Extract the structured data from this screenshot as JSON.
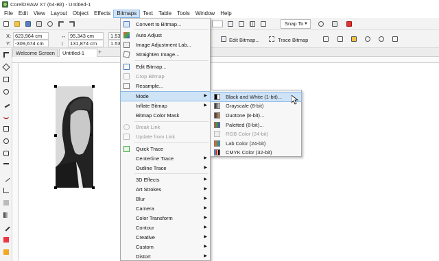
{
  "window": {
    "title": "CorelDRAW X7 (64-Bit) - Untitled-1"
  },
  "menubar": [
    "File",
    "Edit",
    "View",
    "Layout",
    "Object",
    "Effects",
    "Bitmaps",
    "Text",
    "Table",
    "Tools",
    "Window",
    "Help"
  ],
  "active_menu": "Bitmaps",
  "toolbar": {
    "snap_label": "Snap To",
    "x_label": "X:",
    "x_value": "623,964 cm",
    "y_label": "Y:",
    "y_value": "-309,674 cm",
    "w_value": "95,343 cm",
    "h_value": "131,874 cm",
    "scale_w": "1.53",
    "scale_h": "1.53",
    "edit_bitmap": "Edit Bitmap...",
    "trace_bitmap": "Trace Bitmap"
  },
  "tabs": {
    "welcome": "Welcome Screen",
    "document": "Untitled-1",
    "add": "+"
  },
  "bitmaps_menu": [
    {
      "label": "Convert to Bitmap...",
      "disabled": false,
      "icon": "convert-bitmap-icon"
    },
    {
      "label": "Auto Adjust",
      "disabled": false,
      "icon": "auto-adjust-icon"
    },
    {
      "label": "Image Adjustment Lab...",
      "disabled": false,
      "icon": "image-adjustment-icon"
    },
    {
      "label": "Straighten Image...",
      "disabled": false,
      "icon": "straighten-icon"
    },
    {
      "label": "Edit Bitmap...",
      "disabled": false,
      "icon": "edit-bitmap-icon"
    },
    {
      "label": "Crop Bitmap",
      "disabled": true,
      "icon": "crop-icon"
    },
    {
      "label": "Resample...",
      "disabled": false,
      "icon": "resample-icon"
    },
    {
      "label": "Mode",
      "disabled": false,
      "submenu": true,
      "highlight": true
    },
    {
      "label": "Inflate Bitmap",
      "disabled": false,
      "submenu": true
    },
    {
      "label": "Bitmap Color Mask",
      "disabled": false
    },
    {
      "label": "Break Link",
      "disabled": true,
      "icon": "break-link-icon"
    },
    {
      "label": "Update from Link",
      "disabled": true,
      "icon": "update-link-icon"
    },
    {
      "label": "Quick Trace",
      "disabled": false,
      "icon": "quick-trace-icon"
    },
    {
      "label": "Centerline Trace",
      "disabled": false,
      "submenu": true
    },
    {
      "label": "Outline Trace",
      "disabled": false,
      "submenu": true
    },
    {
      "label": "3D Effects",
      "disabled": false,
      "submenu": true
    },
    {
      "label": "Art Strokes",
      "disabled": false,
      "submenu": true
    },
    {
      "label": "Blur",
      "disabled": false,
      "submenu": true
    },
    {
      "label": "Camera",
      "disabled": false,
      "submenu": true
    },
    {
      "label": "Color Transform",
      "disabled": false,
      "submenu": true
    },
    {
      "label": "Contour",
      "disabled": false,
      "submenu": true
    },
    {
      "label": "Creative",
      "disabled": false,
      "submenu": true
    },
    {
      "label": "Custom",
      "disabled": false,
      "submenu": true
    },
    {
      "label": "Distort",
      "disabled": false,
      "submenu": true
    }
  ],
  "mode_submenu": [
    {
      "label": "Black and White (1-bit)...",
      "disabled": false,
      "highlight": true
    },
    {
      "label": "Grayscale (8-bit)",
      "disabled": false
    },
    {
      "label": "Duotone (8-bit)...",
      "disabled": false
    },
    {
      "label": "Paletted (8-bit)...",
      "disabled": false
    },
    {
      "label": "RGB Color (24-bit)",
      "disabled": true
    },
    {
      "label": "Lab Color (24-bit)",
      "disabled": false
    },
    {
      "label": "CMYK Color (32-bit)",
      "disabled": false
    }
  ],
  "colors": {
    "highlight": "#cfe3f7",
    "highlight_border": "#8bb8e6",
    "disabled_text": "#9a9a9a"
  }
}
